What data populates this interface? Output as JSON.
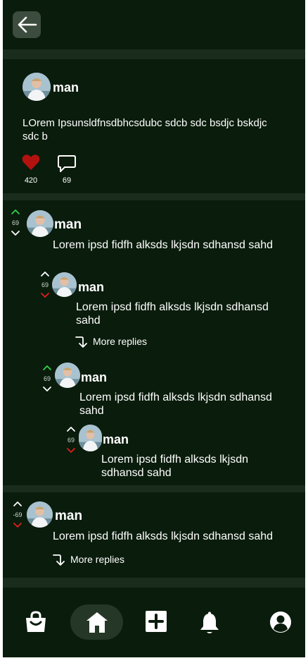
{
  "colors": {
    "background": "#0a1c0c",
    "separator": "#1a2c1b",
    "like": "#b3120f",
    "upvote": "#2fd34a",
    "downvote": "#e01e1e"
  },
  "post": {
    "username": "man",
    "text": "LOrem Ipsunsldfnsdbhcsdubc sdcb sdc bsdjc bskdjc sdc b",
    "likes": "420",
    "comments": "69"
  },
  "comments": [
    {
      "username": "man",
      "text": "Lorem ipsd fidfh alksds lkjsdn sdhansd sahd",
      "votes": "69",
      "vote_state": "up",
      "replies": [
        {
          "username": "man",
          "text": "Lorem ipsd fidfh alksds lkjsdn sdhansd sahd",
          "votes": "69",
          "vote_state": "down",
          "more_replies": "More replies"
        },
        {
          "username": "man",
          "text": "Lorem ipsd fidfh alksds lkjsdn sdhansd sahd",
          "votes": "69",
          "vote_state": "up",
          "replies": [
            {
              "username": "man",
              "text": "Lorem ipsd fidfh alksds lkjsdn sdhansd sahd",
              "votes": "69",
              "vote_state": "down"
            }
          ]
        }
      ]
    },
    {
      "username": "man",
      "text": "Lorem ipsd fidfh alksds lkjsdn sdhansd sahd",
      "votes": "-69",
      "vote_state": "down",
      "more_replies": "More replies"
    }
  ],
  "nav": {
    "items": [
      "shop-icon",
      "home-icon",
      "add-icon",
      "bell-icon",
      "profile-icon"
    ],
    "active": "home-icon"
  }
}
